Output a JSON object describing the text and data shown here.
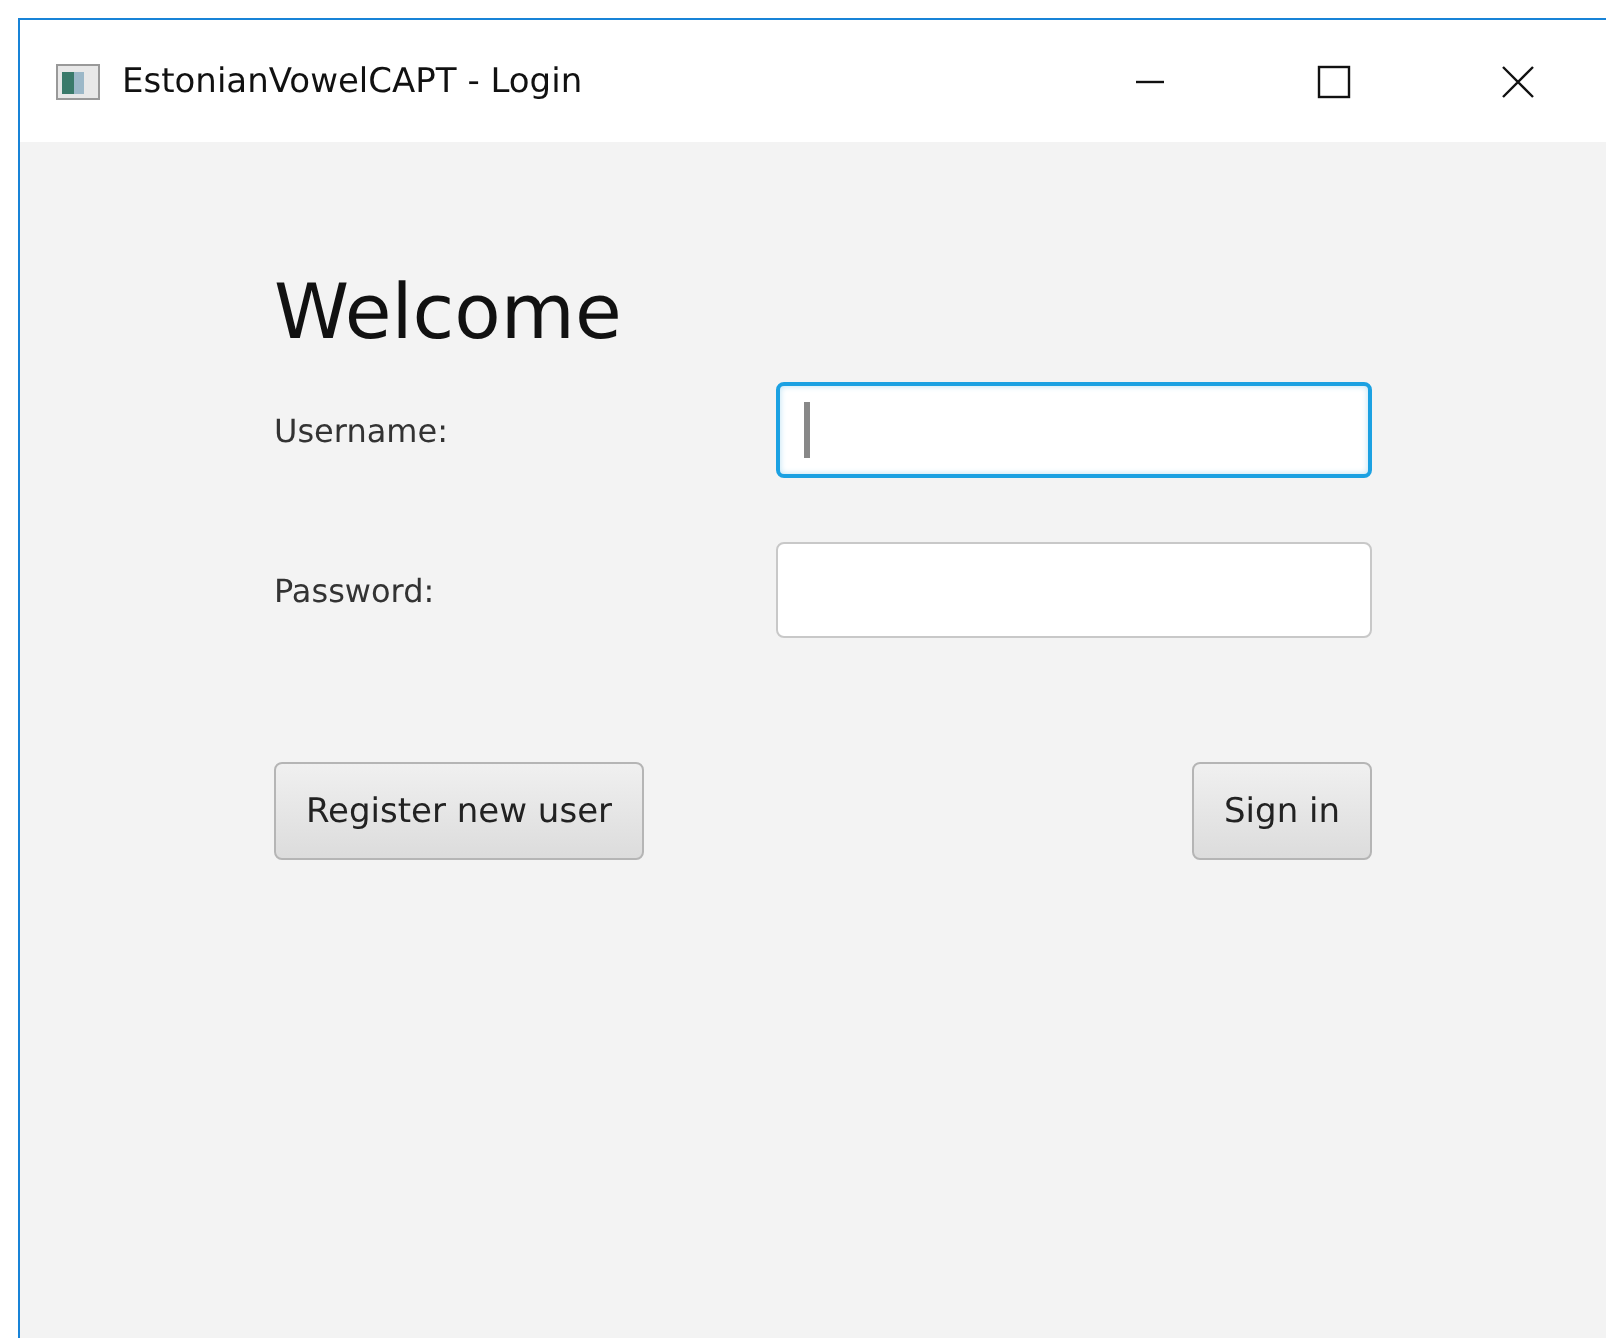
{
  "window": {
    "title": "EstonianVowelCAPT - Login"
  },
  "heading": "Welcome",
  "fields": [
    {
      "label": "Username:",
      "focused": true
    },
    {
      "label": "Password:",
      "focused": false
    }
  ],
  "buttons": [
    {
      "label": "Register new user"
    },
    {
      "label": "Sign in"
    }
  ]
}
